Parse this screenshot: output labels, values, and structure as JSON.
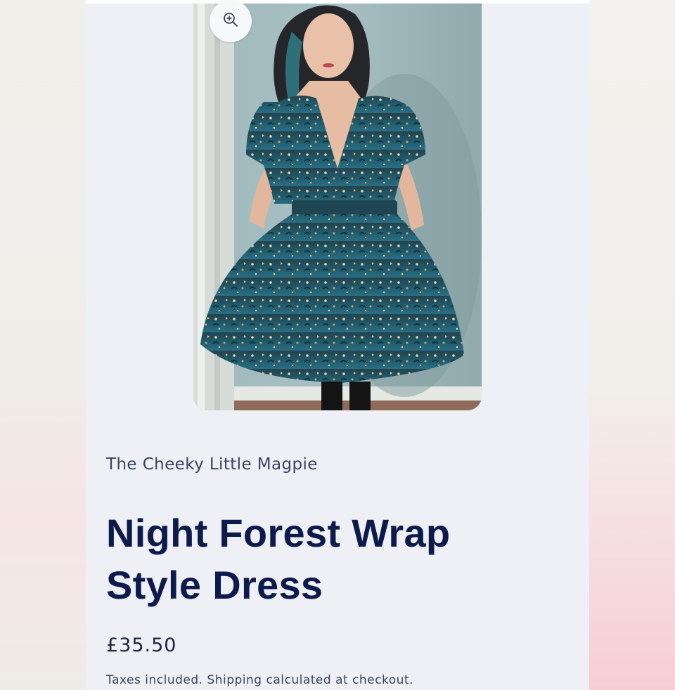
{
  "product": {
    "vendor": "The Cheeky Little Magpie",
    "title": "Night Forest Wrap Style Dress",
    "price": "£35.50",
    "tax_note": "Taxes included. Shipping calculated at checkout."
  },
  "media": {
    "zoom_icon": "zoom-in-icon",
    "photo": "product-photo-dress"
  },
  "colors": {
    "page_bg": "#eef0f5",
    "title": "#0d1b4c",
    "text": "#3a4560",
    "dress_teal": "#1f5a6b"
  }
}
